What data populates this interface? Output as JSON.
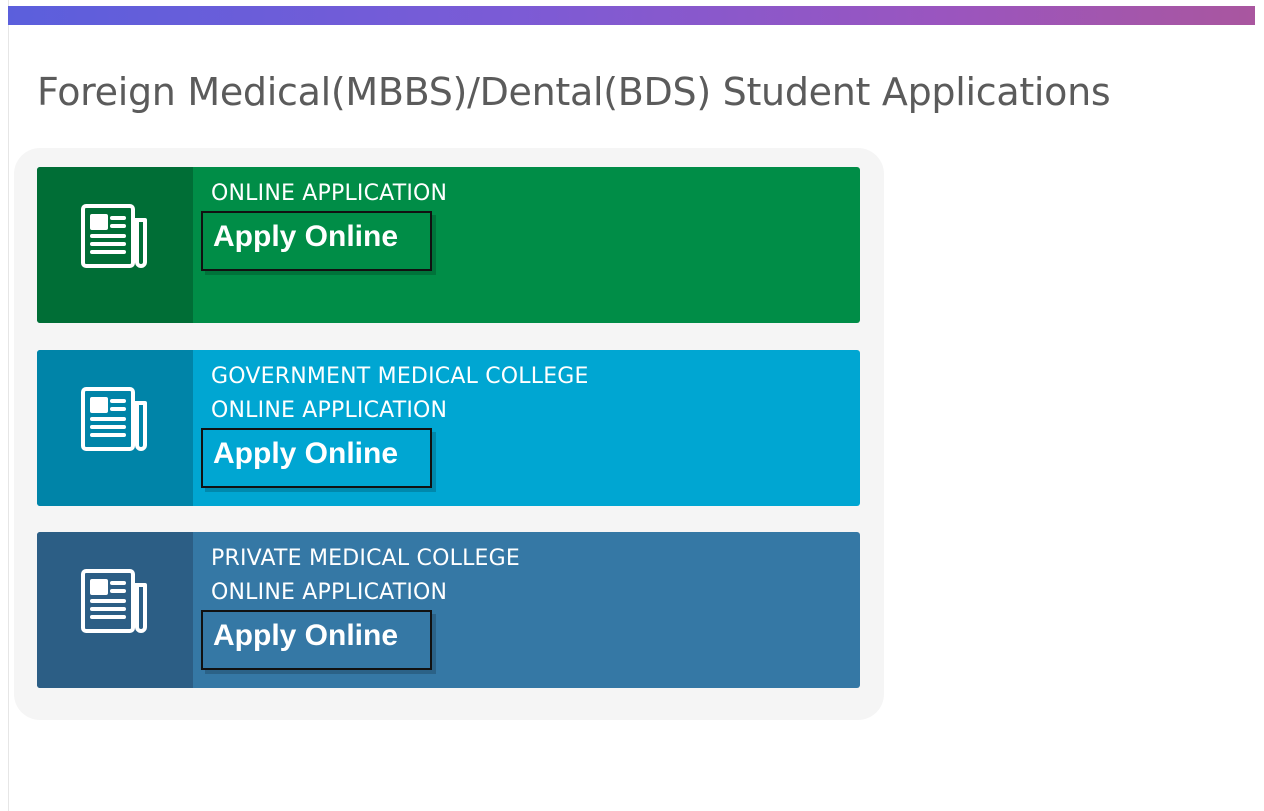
{
  "page": {
    "title": "Foreign Medical(MBBS)/Dental(BDS) Student Applications"
  },
  "cards": [
    {
      "lines": [
        "ONLINE APPLICATION"
      ],
      "action_label": "Apply Online",
      "color": "#008d47",
      "icon": "newspaper-icon"
    },
    {
      "lines": [
        "GOVERNMENT MEDICAL COLLEGE",
        "ONLINE APPLICATION"
      ],
      "action_label": "Apply Online",
      "color": "#00a6d2",
      "icon": "newspaper-icon"
    },
    {
      "lines": [
        "PRIVATE MEDICAL COLLEGE",
        "ONLINE APPLICATION"
      ],
      "action_label": "Apply Online",
      "color": "#3578a5",
      "icon": "newspaper-icon"
    }
  ]
}
